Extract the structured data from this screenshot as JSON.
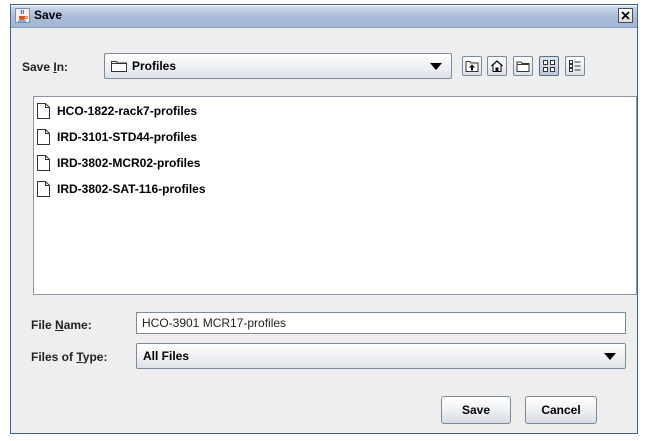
{
  "window": {
    "title": "Save",
    "icon": "java-cup-icon",
    "close_icon": "close-icon"
  },
  "save_in": {
    "label_prefix": "Save ",
    "label_mnemonic": "I",
    "label_suffix": "n:",
    "value": "Profiles",
    "folder_icon": "folder-icon"
  },
  "toolbar": {
    "buttons": [
      {
        "name": "up-one-level-icon"
      },
      {
        "name": "home-icon"
      },
      {
        "name": "new-folder-icon"
      },
      {
        "name": "list-view-icon",
        "active": true
      },
      {
        "name": "details-view-icon"
      }
    ]
  },
  "files": {
    "items": [
      {
        "name": "HCO-1822-rack7-profiles"
      },
      {
        "name": "IRD-3101-STD44-profiles"
      },
      {
        "name": "IRD-3802-MCR02-profiles"
      },
      {
        "name": "IRD-3802-SAT-116-profiles"
      }
    ]
  },
  "file_name": {
    "label_prefix": "File ",
    "label_mnemonic": "N",
    "label_suffix": "ame:",
    "value": "HCO-3901 MCR17-profiles"
  },
  "file_type": {
    "label_prefix": "Files of ",
    "label_mnemonic": "T",
    "label_suffix": "ype:",
    "value": "All Files"
  },
  "actions": {
    "save_label": "Save",
    "cancel_label": "Cancel"
  }
}
